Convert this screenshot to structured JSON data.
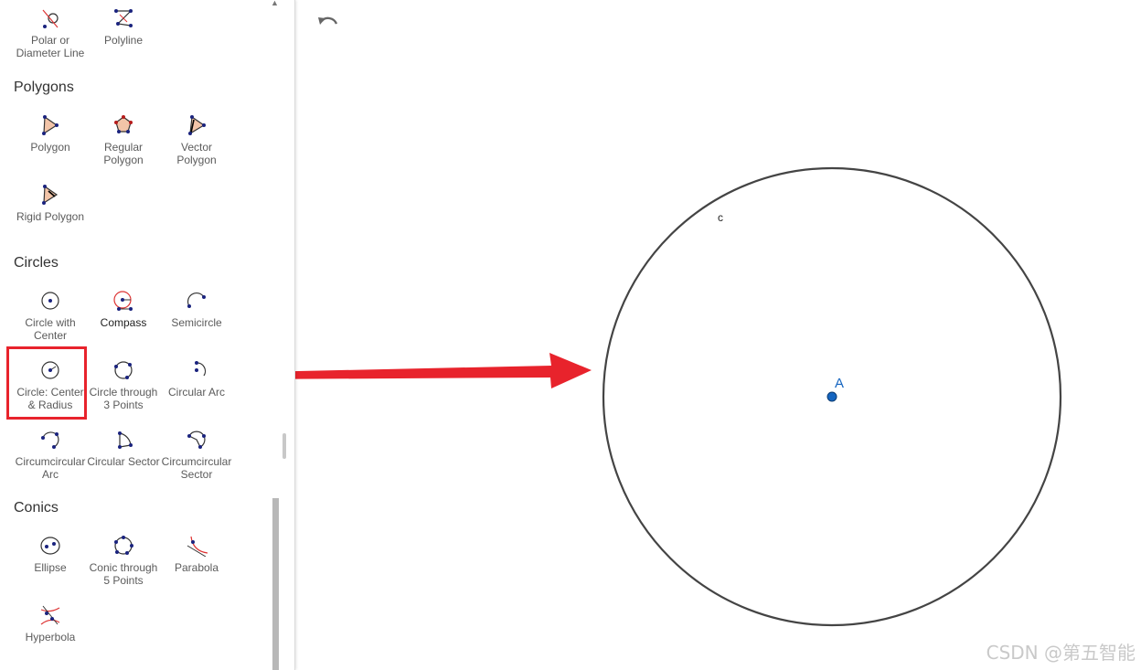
{
  "tools_top": [
    {
      "label": "Polar or Diameter Line",
      "icon": "polar-diameter-line-icon"
    },
    {
      "label": "Polyline",
      "icon": "polyline-icon"
    }
  ],
  "polygons": {
    "title": "Polygons",
    "tools": [
      {
        "label": "Polygon",
        "icon": "polygon-icon"
      },
      {
        "label": "Regular Polygon",
        "icon": "regular-polygon-icon"
      },
      {
        "label": "Vector Polygon",
        "icon": "vector-polygon-icon"
      },
      {
        "label": "Rigid Polygon",
        "icon": "rigid-polygon-icon"
      }
    ]
  },
  "circles": {
    "title": "Circles",
    "tools": [
      {
        "label": "Circle with Center",
        "icon": "circle-with-center-icon"
      },
      {
        "label": "Compass",
        "icon": "compass-icon"
      },
      {
        "label": "Semicircle",
        "icon": "semicircle-icon"
      },
      {
        "label": "Circle: Center & Radius",
        "icon": "circle-center-radius-icon",
        "highlighted": true
      },
      {
        "label": "Circle through 3 Points",
        "icon": "circle-3-points-icon"
      },
      {
        "label": "Circular Arc",
        "icon": "circular-arc-icon"
      },
      {
        "label": "Circumcircular Arc",
        "icon": "circumcircular-arc-icon"
      },
      {
        "label": "Circular Sector",
        "icon": "circular-sector-icon"
      },
      {
        "label": "Circumcircular Sector",
        "icon": "circumcircular-sector-icon"
      }
    ]
  },
  "conics": {
    "title": "Conics",
    "tools": [
      {
        "label": "Ellipse",
        "icon": "ellipse-icon"
      },
      {
        "label": "Conic through 5 Points",
        "icon": "conic-5-points-icon"
      },
      {
        "label": "Parabola",
        "icon": "parabola-icon"
      },
      {
        "label": "Hyperbola",
        "icon": "hyperbola-icon"
      }
    ]
  },
  "toolbar": {
    "undo_icon": "undo-icon"
  },
  "graphics": {
    "circle_label": "c",
    "point_label": "A",
    "circle_color": "#444444",
    "point_color": "#1565c0"
  },
  "annotation": {
    "arrow_color": "#e8232c",
    "highlight_color": "#e8232c"
  },
  "watermark": "CSDN @第五智能"
}
